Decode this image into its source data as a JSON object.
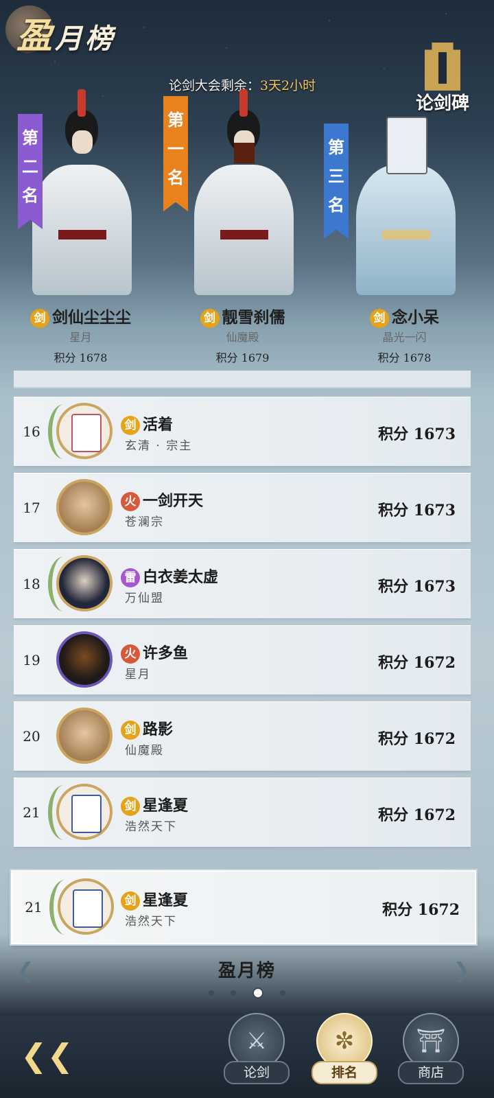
{
  "header": {
    "title_main": "盈",
    "title_rest": "月榜",
    "countdown_label": "论剑大会剩余：",
    "countdown_value": "3天2小时",
    "stele_label": "论剑碑"
  },
  "podium": [
    {
      "rank_label": "第二名",
      "badge": "剑",
      "name": "剑仙尘尘尘",
      "sect": "星月",
      "score": "积分 1678",
      "flag_color": "#8a5bd0"
    },
    {
      "rank_label": "第一名",
      "badge": "剑",
      "name": "靓雪刹儒",
      "sect": "仙魔殿",
      "score": "积分 1679",
      "flag_color": "#e8821f"
    },
    {
      "rank_label": "第三名",
      "badge": "剑",
      "name": "念小呆",
      "sect": "晶光一闪",
      "score": "积分 1678",
      "flag_color": "#3d78d0"
    }
  ],
  "rows": [
    {
      "rank": "16",
      "badge": "剑",
      "badge_type": "sword",
      "name": "活着",
      "sect": "玄清 · 宗主",
      "score": "积分 1673",
      "avatar": "mahjong-red-tile-icon"
    },
    {
      "rank": "17",
      "badge": "火",
      "badge_type": "fire",
      "name": "一剑开天",
      "sect": "苍澜宗",
      "score": "积分 1673",
      "avatar": "blonde-character-avatar"
    },
    {
      "rank": "18",
      "badge": "雷",
      "badge_type": "thunder",
      "name": "白衣姜太虚",
      "sect": "万仙盟",
      "score": "积分 1673",
      "avatar": "dark-hair-character-avatar"
    },
    {
      "rank": "19",
      "badge": "火",
      "badge_type": "fire",
      "name": "许多鱼",
      "sect": "星月",
      "score": "积分 1672",
      "avatar": "veiled-character-avatar"
    },
    {
      "rank": "20",
      "badge": "剑",
      "badge_type": "sword",
      "name": "路影",
      "sect": "仙魔殿",
      "score": "积分 1672",
      "avatar": "blonde-character-avatar"
    },
    {
      "rank": "21",
      "badge": "剑",
      "badge_type": "sword",
      "name": "星逢夏",
      "sect": "浩然天下",
      "score": "积分 1672",
      "avatar": "mahjong-blue-tile-icon"
    }
  ],
  "my_rank": {
    "rank": "21",
    "badge": "剑",
    "name": "星逢夏",
    "sect": "浩然天下",
    "score": "积分 1672"
  },
  "pager": {
    "label": "盈月榜",
    "pages": 4,
    "current_page": 3
  },
  "nav": [
    {
      "label": "论剑",
      "icon": "crossed-swords-icon",
      "active": false
    },
    {
      "label": "排名",
      "icon": "rank-emblem-icon",
      "active": true
    },
    {
      "label": "商店",
      "icon": "pagoda-icon",
      "active": false
    }
  ]
}
